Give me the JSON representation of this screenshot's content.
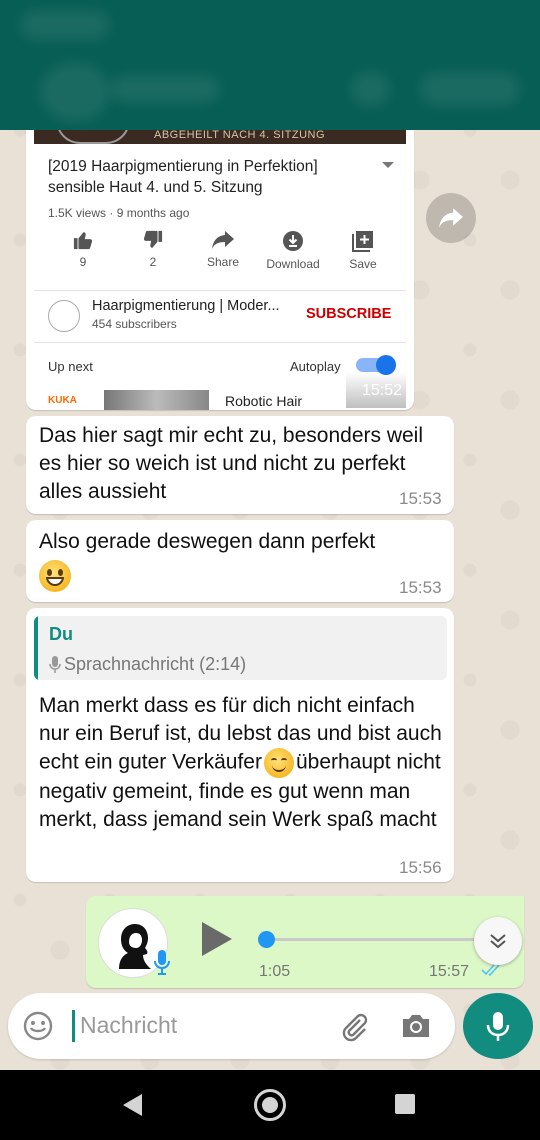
{
  "youtube": {
    "thumb_caption": "ABGEHEILT NACH 4. SITZUNG",
    "title": "[2019 Haarpigmentierung in Perfektion] sensible Haut 4. und 5. Sitzung",
    "meta": "1.5K views · 9 months ago",
    "actions": [
      {
        "label": "9",
        "icon": "thumb-up-icon"
      },
      {
        "label": "2",
        "icon": "thumb-down-icon"
      },
      {
        "label": "Share",
        "icon": "share-icon"
      },
      {
        "label": "Download",
        "icon": "download-icon"
      },
      {
        "label": "Save",
        "icon": "save-playlist-icon"
      }
    ],
    "channel_name": "Haarpigmentierung | Moder...",
    "channel_subs": "454 subscribers",
    "subscribe": "SUBSCRIBE",
    "up_next": "Up next",
    "autoplay": "Autoplay",
    "next_channel_logo": "KUKA",
    "next_title": "Robotic Hair",
    "time": "15:52"
  },
  "messages": [
    {
      "text": "Das hier sagt mir echt zu, besonders weil es hier so weich ist und nicht zu perfekt alles aussieht",
      "time": "15:53"
    },
    {
      "text": "Also gerade deswegen dann perfekt",
      "emoji": "grinning-face",
      "time": "15:53"
    },
    {
      "quote_author": "Du",
      "quote_text": "Sprachnachricht (2:14)",
      "text_part1": "Man merkt dass es für dich nicht einfach nur ein Beruf ist, du lebst das und bist auch echt ein guter Verkäufer",
      "emoji": "smiling-face",
      "text_part2": "überhaupt nicht negativ gemeint, finde es gut wenn man merkt, dass jemand sein Werk spaß macht",
      "time": "15:56"
    }
  ],
  "voice_note": {
    "duration": "1:05",
    "time": "15:57",
    "status": "read"
  },
  "input": {
    "placeholder": "Nachricht"
  },
  "colors": {
    "header": "#075E54",
    "accent": "#128C7E",
    "outgoing": "#DCF8C6",
    "subscribe": "#CC0000",
    "read_ticks": "#4FC3F7"
  }
}
